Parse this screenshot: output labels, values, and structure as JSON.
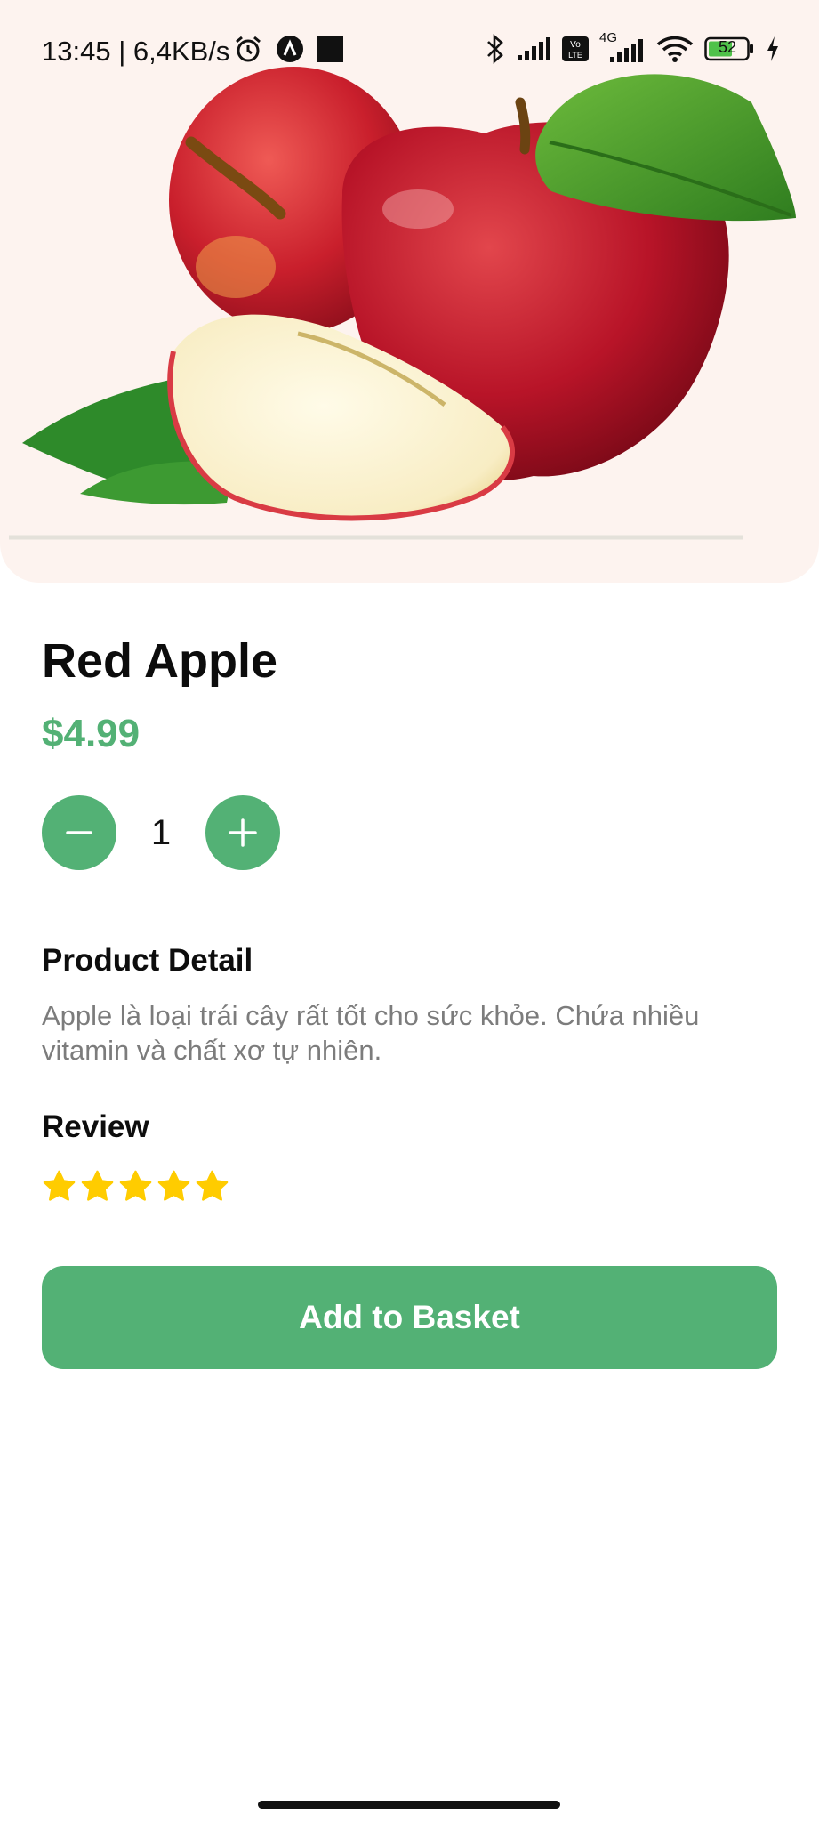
{
  "status_bar": {
    "time": "13:45 | 6,4KB/s",
    "battery_level": "52",
    "network": "4G",
    "icons": [
      "alarm-icon",
      "app-notification-icon",
      "stop-icon",
      "bluetooth-icon",
      "signal-icon",
      "volte-icon",
      "signal-4g-icon",
      "wifi-icon",
      "battery-icon",
      "charging-icon"
    ]
  },
  "product": {
    "image": "red-apple-image",
    "name": "Red Apple",
    "price": "$4.99",
    "quantity": "1"
  },
  "quantity_controls": {
    "decrease_icon": "minus-icon",
    "increase_icon": "plus-icon"
  },
  "detail": {
    "title": "Product Detail",
    "text": "Apple là loại trái cây rất tốt cho sức khỏe. Chứa nhiều vitamin và chất xơ tự nhiên."
  },
  "review": {
    "title": "Review",
    "rating": 5,
    "max_rating": 5
  },
  "actions": {
    "add_to_basket": "Add to Basket"
  },
  "colors": {
    "accent": "#53B175",
    "star": "#FFCC00",
    "hero_background": "#FDF3EF",
    "detail_text": "#7C7C7C"
  }
}
